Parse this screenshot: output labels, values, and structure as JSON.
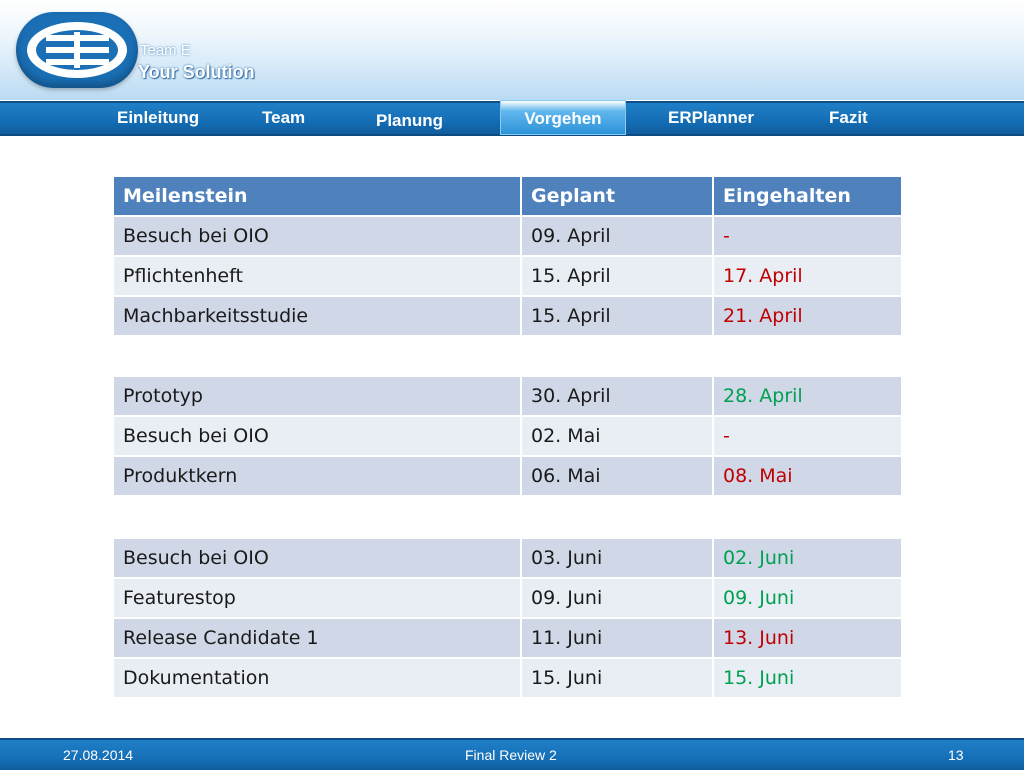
{
  "brand": {
    "team": "Team E",
    "name": "Your Solution",
    "logo": "ee-logo",
    "logo_color": "#1a6fb5"
  },
  "nav": {
    "items": [
      "Einleitung",
      "Team",
      "Planung",
      "Vorgehen",
      "ERPlanner",
      "Fazit"
    ],
    "active": "Vorgehen"
  },
  "table": {
    "headers": [
      "Meilenstein",
      "Geplant",
      "Eingehalten"
    ],
    "groups": [
      [
        {
          "milestone": "Besuch bei OIO",
          "planned": "09. April",
          "kept": "-",
          "status": "none"
        },
        {
          "milestone": "Pflichtenheft",
          "planned": "15. April",
          "kept": "17. April",
          "status": "late"
        },
        {
          "milestone": "Machbarkeitsstudie",
          "planned": "15. April",
          "kept": "21. April",
          "status": "late"
        }
      ],
      [
        {
          "milestone": "Prototyp",
          "planned": "30. April",
          "kept": "28. April",
          "status": "ontime"
        },
        {
          "milestone": "Besuch bei OIO",
          "planned": "02. Mai",
          "kept": "-",
          "status": "none"
        },
        {
          "milestone": "Produktkern",
          "planned": "06. Mai",
          "kept": "08. Mai",
          "status": "late"
        }
      ],
      [
        {
          "milestone": "Besuch bei OIO",
          "planned": "03. Juni",
          "kept": "02. Juni",
          "status": "ontime"
        },
        {
          "milestone": "Featurestop",
          "planned": "09. Juni",
          "kept": "09. Juni",
          "status": "ontime"
        },
        {
          "milestone": "Release Candidate 1",
          "planned": "11. Juni",
          "kept": "13. Juni",
          "status": "late"
        },
        {
          "milestone": "Dokumentation",
          "planned": "15. Juni",
          "kept": "15. Juni",
          "status": "ontime"
        }
      ]
    ],
    "colors": {
      "header": "#4f81bd",
      "late": "#c00000",
      "ontime": "#00a050"
    }
  },
  "footer": {
    "date": "27.08.2014",
    "title": "Final Review 2",
    "page": "13"
  }
}
